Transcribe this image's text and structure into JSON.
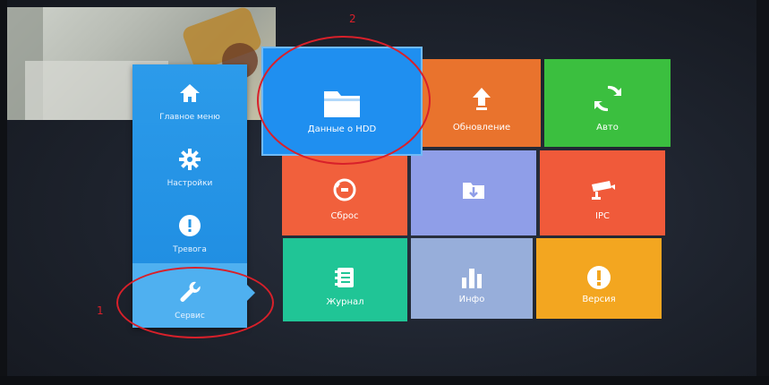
{
  "sidebar": {
    "items": [
      {
        "label": "Главное меню",
        "icon": "home-icon"
      },
      {
        "label": "Настройки",
        "icon": "gear-icon"
      },
      {
        "label": "Тревога",
        "icon": "alert-icon"
      },
      {
        "label": "Сервис",
        "icon": "wrench-icon"
      }
    ]
  },
  "tiles": [
    {
      "label": "Данные о HDD",
      "icon": "folder-icon",
      "color": "#1f8ff0"
    },
    {
      "label": "Обновление",
      "icon": "upload-icon",
      "color": "#e9732d"
    },
    {
      "label": "Авто",
      "icon": "refresh-icon",
      "color": "#3bbf3f"
    },
    {
      "label": "Сброс",
      "icon": "reset-icon",
      "color": "#f1603c"
    },
    {
      "label": "",
      "icon": "import-icon",
      "color": "#8f9ee8"
    },
    {
      "label": "IPC",
      "icon": "camera-icon",
      "color": "#f05a3a"
    },
    {
      "label": "Журнал",
      "icon": "log-icon",
      "color": "#20c596"
    },
    {
      "label": "Инфо",
      "icon": "chart-icon",
      "color": "#97aeda"
    },
    {
      "label": "Версия",
      "icon": "info-icon",
      "color": "#f3a620"
    }
  ],
  "annotations": {
    "mark_1": "1",
    "mark_2": "2",
    "highlight_color": "#d8202a"
  }
}
